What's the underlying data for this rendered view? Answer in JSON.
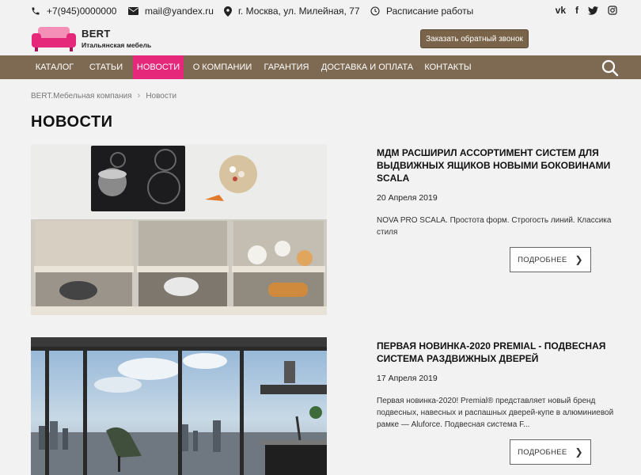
{
  "topbar": {
    "phone": "+7(945)0000000",
    "email": "mail@yandex.ru",
    "address": "г. Москва, ул. Милейная, 77",
    "schedule": "Расписание работы",
    "social": [
      "vk",
      "f",
      "twitter",
      "instagram"
    ]
  },
  "header": {
    "brand": "BERT",
    "tagline": "Итальянская мебель",
    "callback_label": "Заказать обратный звонок"
  },
  "nav": {
    "items": [
      {
        "label": "Каталог"
      },
      {
        "label": "Статьи"
      },
      {
        "label": "Новости"
      },
      {
        "label": "О компании"
      },
      {
        "label": "Гарантия"
      },
      {
        "label": "Доставка и оплата"
      },
      {
        "label": "Контакты"
      }
    ],
    "active": "Новости"
  },
  "breadcrumb": {
    "home": "BERT.Мебельная компания",
    "current": "Новости"
  },
  "page_title": "НОВОСТИ",
  "news": [
    {
      "title": "МДМ расширил ассортимент систем для выдвижных ящиков новыми боковинами SCALA",
      "date": "20 Апреля 2019",
      "excerpt": "NOVA PRO SCALA. Простота форм. Строгость линий. Классика стиля",
      "more_label": "ПОДРОБНЕЕ"
    },
    {
      "title": "Первая новинка-2020 PREMIAL - подвесная система раздвижных дверей",
      "date": "17 Апреля 2019",
      "excerpt": "Первая новинка-2020! Premial® представляет новый бренд подвесных, навесных и распашных дверей-купе в алюминиевой рамке — Aluforce. Подвесная система F...",
      "more_label": "ПОДРОБНЕЕ"
    }
  ],
  "colors": {
    "accent": "#e5287a",
    "nav_bg": "#7e6a52",
    "button_bg": "#7a6449",
    "page_bg": "#f2f2f2"
  }
}
